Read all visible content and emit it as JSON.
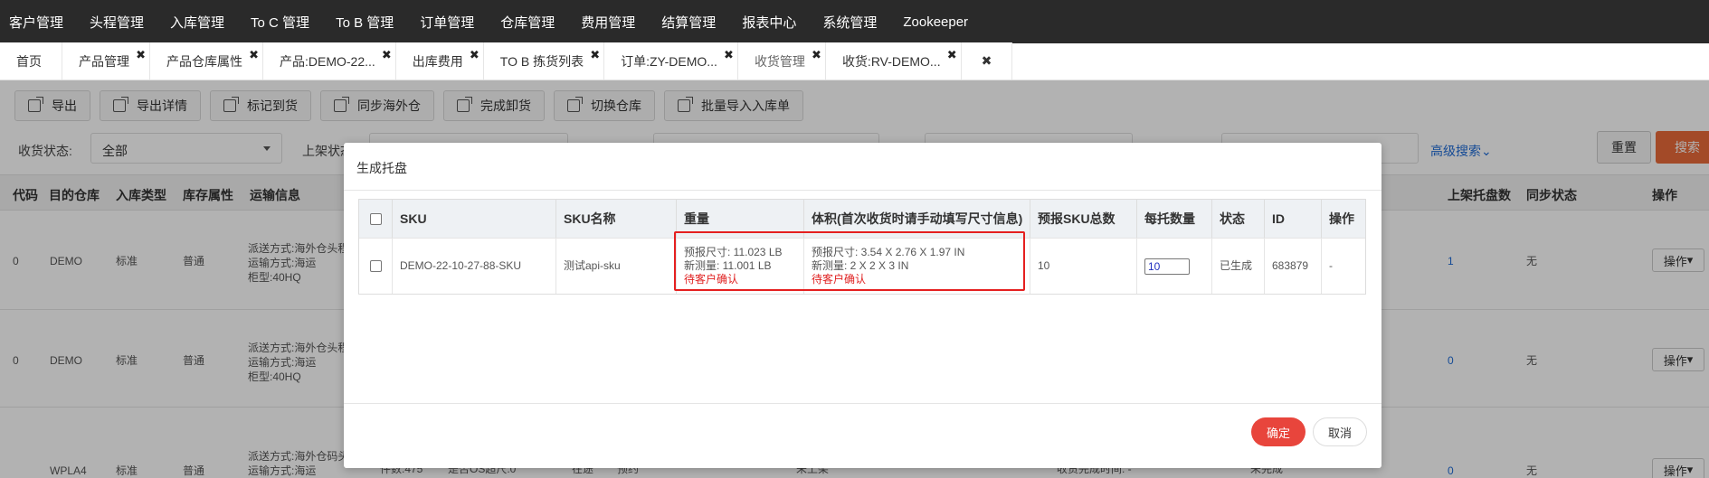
{
  "topnav": [
    "客户管理",
    "头程管理",
    "入库管理",
    "To C 管理",
    "To B 管理",
    "订单管理",
    "仓库管理",
    "费用管理",
    "结算管理",
    "报表中心",
    "系统管理",
    "Zookeeper"
  ],
  "tabs": [
    {
      "label": "首页",
      "closable": false
    },
    {
      "label": "产品管理",
      "closable": true
    },
    {
      "label": "产品仓库属性",
      "closable": true
    },
    {
      "label": "产品:DEMO-22...",
      "closable": true
    },
    {
      "label": "出库费用",
      "closable": true
    },
    {
      "label": "TO B 拣货列表",
      "closable": true
    },
    {
      "label": "订单:ZY-DEMO...",
      "closable": true
    },
    {
      "label": "收货管理",
      "closable": true,
      "active": true
    },
    {
      "label": "收货:RV-DEMO...",
      "closable": true
    }
  ],
  "close_all": "✖",
  "toolbar": [
    "导出",
    "导出详情",
    "标记到货",
    "同步海外仓",
    "完成卸货",
    "切换仓库",
    "批量导入入库单"
  ],
  "filters": {
    "status_label": "收货状态:",
    "status_value": "全部",
    "shelf_label": "上架状态",
    "advanced": "高级搜索",
    "reset": "重置",
    "search": "搜索"
  },
  "bg_table": {
    "headers": [
      "代码",
      "目的仓库",
      "入库类型",
      "库存属性",
      "运输信息",
      "上架托盘数",
      "同步状态",
      "操作"
    ],
    "rows": [
      {
        "code": "0",
        "warehouse": "DEMO",
        "type": "标准",
        "attr": "普通",
        "ship1": "派送方式:海外仓头程",
        "ship2": "运输方式:海运",
        "ship3": "柜型:40HQ",
        "pallets": "1",
        "sync": "无",
        "op": "操作"
      },
      {
        "code": "0",
        "warehouse": "DEMO",
        "type": "标准",
        "attr": "普通",
        "ship1": "派送方式:海外仓头程",
        "ship2": "运输方式:海运",
        "ship3": "柜型:40HQ",
        "pallets": "0",
        "sync": "无",
        "op": "操作"
      },
      {
        "code": "",
        "warehouse": "WPLA4",
        "type": "标准",
        "attr": "普通",
        "ship1": "派送方式:海外仓码头",
        "ship2": "运输方式:海运",
        "ship3": "",
        "pallets": "0",
        "sync": "无",
        "op": "操作",
        "extra1": "件数:475",
        "extra2": "是否OS超尺:0",
        "extra3": "在途",
        "extra4": "预约",
        "extra5": "未上架",
        "extra6": "未完成",
        "extra7": "收货完成时间: -"
      }
    ]
  },
  "modal": {
    "title": "生成托盘",
    "headers": [
      "SKU",
      "SKU名称",
      "重量",
      "体积(首次收货时请手动填写尺寸信息)",
      "预报SKU总数",
      "每托数量",
      "状态",
      "ID",
      "操作"
    ],
    "row": {
      "sku": "DEMO-22-10-27-88-SKU",
      "name": "测试api-sku",
      "weight_forecast": "预报尺寸: 11.023 LB",
      "weight_measured": "新测量: 11.001 LB",
      "weight_status": "待客户确认",
      "volume_forecast": "预报尺寸: 3.54 X 2.76 X 1.97 IN",
      "volume_measured": "新测量: 2 X 2 X 3 IN",
      "volume_status": "待客户确认",
      "total": "10",
      "per_pallet": "10",
      "status": "已生成",
      "id": "683879",
      "op": "-"
    },
    "ok": "确定",
    "cancel": "取消"
  }
}
